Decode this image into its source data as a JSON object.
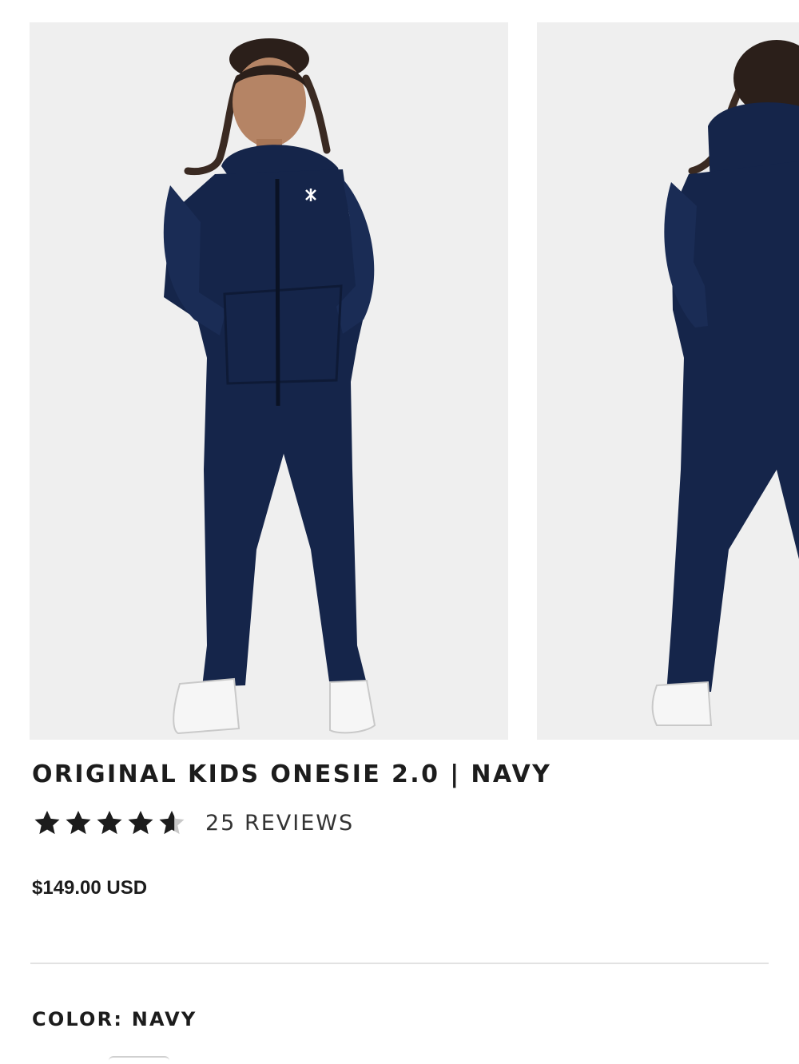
{
  "product": {
    "title": "ORIGINAL KIDS ONESIE 2.0 | NAVY",
    "rating": 4.6,
    "reviews_label": "25 REVIEWS",
    "price": "$149.00 USD",
    "color_label": "COLOR:",
    "color_value": "NAVY"
  },
  "gallery": {
    "images": [
      "front-view",
      "back-view"
    ]
  },
  "colors": {
    "garment": "#15254a",
    "photo_background": "#efefef",
    "star": "#1c1c1c",
    "star_empty": "#c8c8c8"
  },
  "icons": [
    "star-icon",
    "star-half-icon",
    "logo-mark"
  ]
}
